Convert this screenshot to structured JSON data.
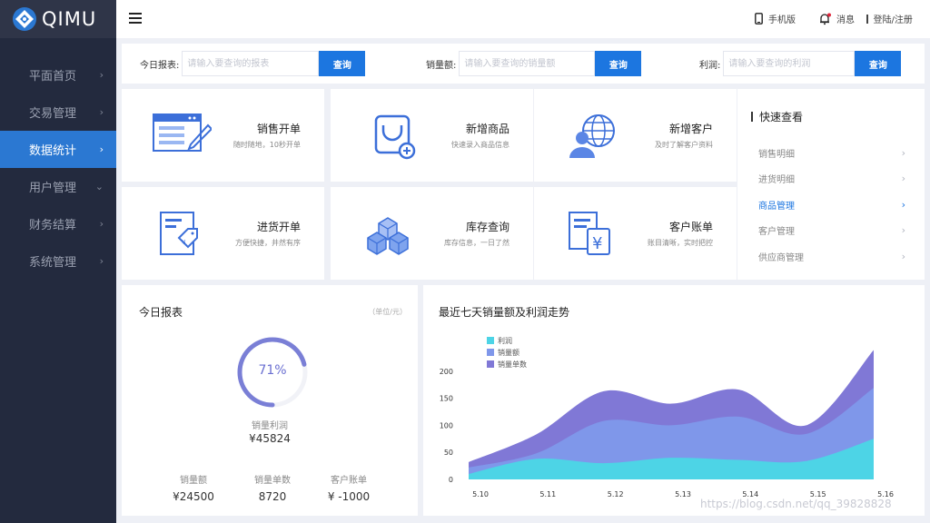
{
  "brand": {
    "name": "QIMU"
  },
  "sidebar": {
    "items": [
      {
        "label": "平面首页",
        "chevron": "›",
        "active": false
      },
      {
        "label": "交易管理",
        "chevron": "›",
        "active": false
      },
      {
        "label": "数据统计",
        "chevron": "›",
        "active": true
      },
      {
        "label": "用户管理",
        "chevron": "⌄",
        "active": false
      },
      {
        "label": "财务结算",
        "chevron": "›",
        "active": false
      },
      {
        "label": "系统管理",
        "chevron": "›",
        "active": false
      }
    ]
  },
  "topbar": {
    "mobile_label": "手机版",
    "messages_label": "消息",
    "login_label": "登陆/注册"
  },
  "search": {
    "report": {
      "label": "今日报表:",
      "placeholder": "请输入要查询的报表",
      "button": "查询"
    },
    "sales": {
      "label": "销量额:",
      "placeholder": "请输入要查询的销量额",
      "button": "查询"
    },
    "profit": {
      "label": "利润:",
      "placeholder": "请输入要查询的利润",
      "button": "查询"
    }
  },
  "actions": [
    {
      "title": "销售开单",
      "subtitle": "随时随地，10秒开单",
      "icon": "sales-form-icon"
    },
    {
      "title": "新增商品",
      "subtitle": "快速录入商品信息",
      "icon": "shopping-bag-icon"
    },
    {
      "title": "新增客户",
      "subtitle": "及时了解客户资料",
      "icon": "customer-globe-icon"
    },
    {
      "title": "进货开单",
      "subtitle": "方便快捷，井然有序",
      "icon": "purchase-doc-icon"
    },
    {
      "title": "库存查询",
      "subtitle": "库存信息，一日了然",
      "icon": "inventory-boxes-icon"
    },
    {
      "title": "客户账单",
      "subtitle": "账目清晰，实时把控",
      "icon": "yuan-bill-icon"
    }
  ],
  "quick": {
    "title": "快速查看",
    "items": [
      {
        "label": "销售明细",
        "active": false
      },
      {
        "label": "进货明细",
        "active": false
      },
      {
        "label": "商品管理",
        "active": true
      },
      {
        "label": "客户管理",
        "active": false
      },
      {
        "label": "供应商管理",
        "active": false
      }
    ]
  },
  "report": {
    "title": "今日报表",
    "unit": "（单位/元）",
    "percent": 71,
    "percent_label": "71%",
    "profit_label": "销量利润",
    "profit_value": "¥45824",
    "stats": [
      {
        "label": "销量额",
        "value": "¥24500"
      },
      {
        "label": "销量单数",
        "value": "8720"
      },
      {
        "label": "客户账单",
        "value": "¥ -1000"
      }
    ]
  },
  "colors": {
    "primary": "#1c76e0",
    "sidebar_bg": "#232a3e",
    "ring": "#7a7fd6",
    "series": [
      "#4dd4e6",
      "#7f97ea",
      "#8078d6"
    ]
  },
  "chart_data": {
    "type": "area",
    "stacked": true,
    "title": "最近七天销量额及利润走势",
    "x": [
      "5.10",
      "5.11",
      "5.12",
      "5.13",
      "5.14",
      "5.15",
      "5.16"
    ],
    "y_ticks": [
      0,
      50,
      100,
      150,
      200
    ],
    "ylim": [
      0,
      250
    ],
    "legend_position": "top-left",
    "series": [
      {
        "name": "利润",
        "values": [
          10,
          38,
          30,
          40,
          36,
          34,
          75
        ]
      },
      {
        "name": "销量额",
        "values": [
          12,
          10,
          78,
          60,
          80,
          50,
          94
        ]
      },
      {
        "name": "销量单数",
        "values": [
          10,
          35,
          55,
          40,
          50,
          16,
          70
        ]
      }
    ]
  },
  "watermark": "https://blog.csdn.net/qq_39828828"
}
